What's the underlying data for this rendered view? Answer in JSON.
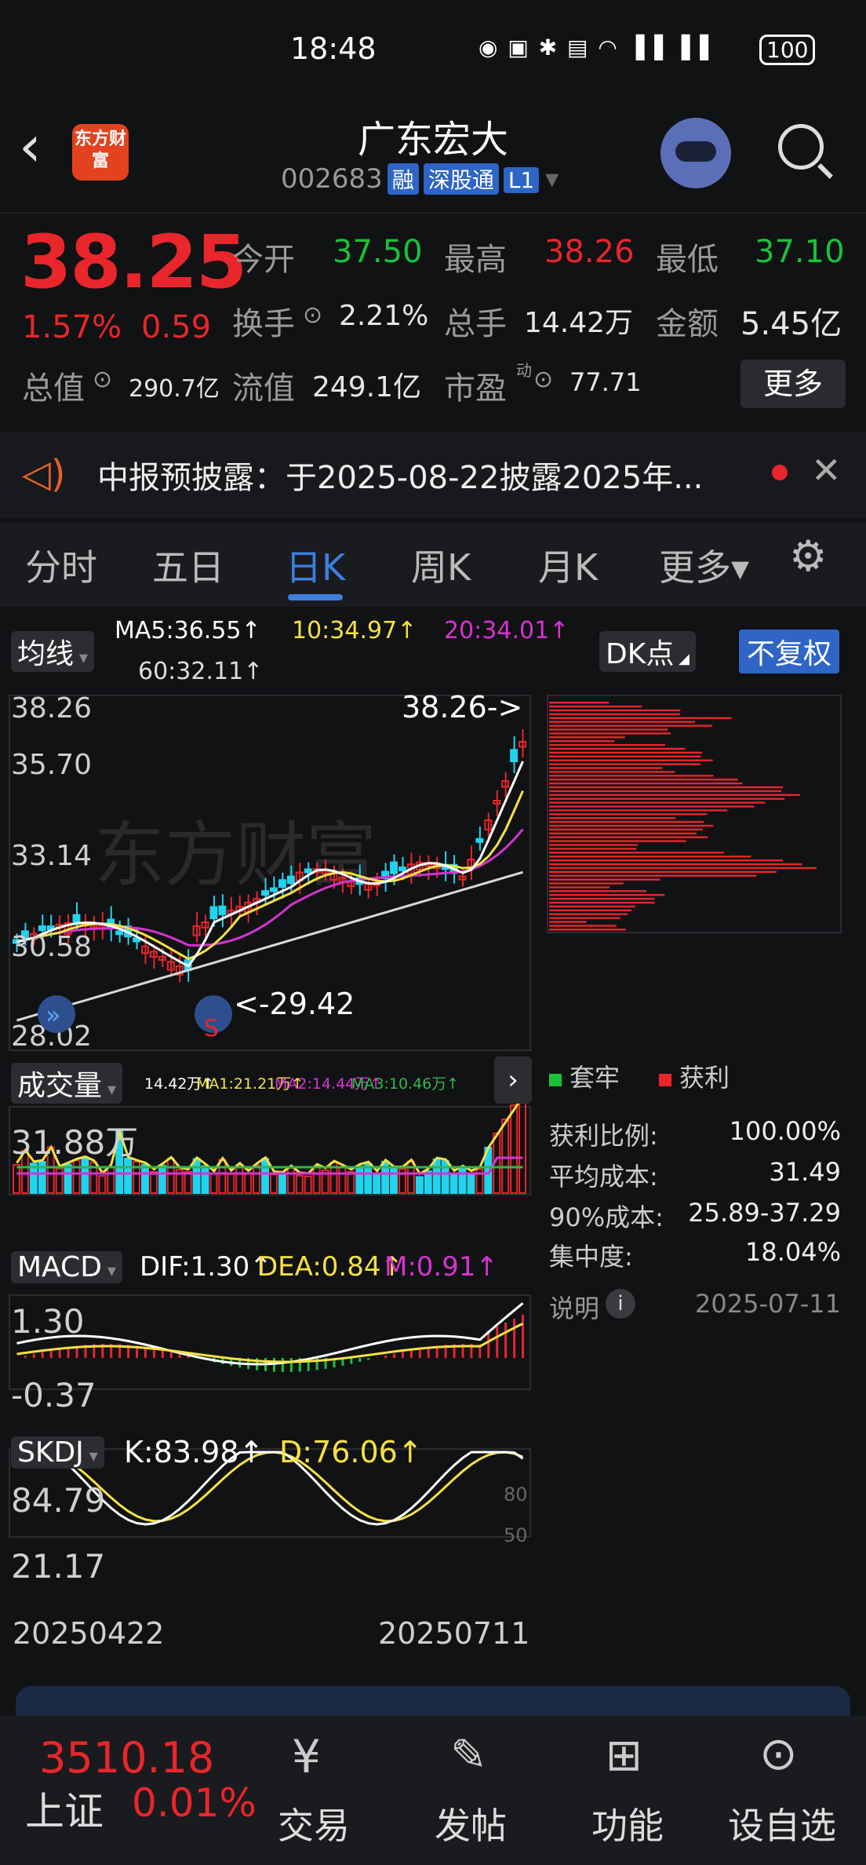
{
  "status_bar": {
    "time": "18:48",
    "battery": "100"
  },
  "header": {
    "logo_text": "东方财富",
    "stock_name": "广东宏大",
    "code": "002683",
    "tags": [
      "融",
      "深股通",
      "L1"
    ]
  },
  "quote": {
    "price": "38.25",
    "change_pct": "1.57%",
    "change": "0.59",
    "open_label": "今开",
    "open": "37.50",
    "high_label": "最高",
    "high": "38.26",
    "low_label": "最低",
    "low": "37.10",
    "turnover_label": "换手",
    "turnover": "2.21%",
    "volume_label": "总手",
    "volume": "14.42万",
    "amount_label": "金额",
    "amount": "5.45亿",
    "mktcap_label": "总值",
    "mktcap": "290.7亿",
    "float_label": "流值",
    "float_cap": "249.1亿",
    "pe_label": "市盈",
    "pe_sup": "动",
    "pe": "77.71",
    "more_button": "更多"
  },
  "notice": {
    "text": "中报预披露：于2025-08-22披露2025年..."
  },
  "tabs": [
    {
      "label": "分时",
      "active": false
    },
    {
      "label": "五日",
      "active": false
    },
    {
      "label": "日K",
      "active": true
    },
    {
      "label": "周K",
      "active": false
    },
    {
      "label": "月K",
      "active": false
    },
    {
      "label": "更多▾",
      "active": false
    }
  ],
  "ma_bar": {
    "selector": "均线",
    "ma5": "MA5:36.55↑",
    "ma10": "10:34.97↑",
    "ma20": "20:34.01↑",
    "ma60": "60:32.11↑",
    "dk_button": "DK点",
    "adjust_button": "不复权"
  },
  "kline": {
    "y_labels": [
      "38.26",
      "35.70",
      "33.14",
      "30.58",
      "28.02"
    ],
    "high_marker": "38.26->",
    "low_marker": "<-29.42",
    "watermark": "东方财富"
  },
  "volume_bar": {
    "selector": "成交量",
    "vol": "14.42万↑",
    "ma1": "MA1:21.21万↑",
    "ma2": "MA2:14.44万↑",
    "ma3": "MA3:10.46万↑",
    "y_label": "31.88万"
  },
  "macd_bar": {
    "selector": "MACD",
    "dif": "DIF:1.30↑",
    "dea": "DEA:0.84↑",
    "m": "M:0.91↑",
    "y_top": "1.30",
    "y_bottom": "-0.37"
  },
  "skdj_bar": {
    "selector": "SKDJ",
    "k": "K:83.98↑",
    "d": "D:76.06↑",
    "y_top": "84.79",
    "y_bottom": "21.17",
    "right_top": "80",
    "right_mid": "50"
  },
  "dates": {
    "start": "20250422",
    "end": "20250711"
  },
  "chip": {
    "legend_trapped": "套牢",
    "legend_profit": "获利",
    "rows": [
      {
        "label": "获利比例:",
        "value": "100.00%"
      },
      {
        "label": "平均成本:",
        "value": "31.49"
      },
      {
        "label": "90%成本:",
        "value": "25.89-37.29"
      },
      {
        "label": "集中度:",
        "value": "18.04%"
      }
    ],
    "note_label": "说明",
    "date": "2025-07-11"
  },
  "bottom_nav": {
    "index_value": "3510.18",
    "index_name": "上证",
    "index_change": "0.01%",
    "items": [
      "交易",
      "发帖",
      "功能",
      "设自选"
    ]
  },
  "colors": {
    "up": "#e8262b",
    "down": "#18c33a",
    "accent": "#3d7fe0",
    "ma5": "#ffffff",
    "ma10": "#f5e142",
    "ma20": "#d633d0",
    "ma60": "#d8d8d8"
  }
}
